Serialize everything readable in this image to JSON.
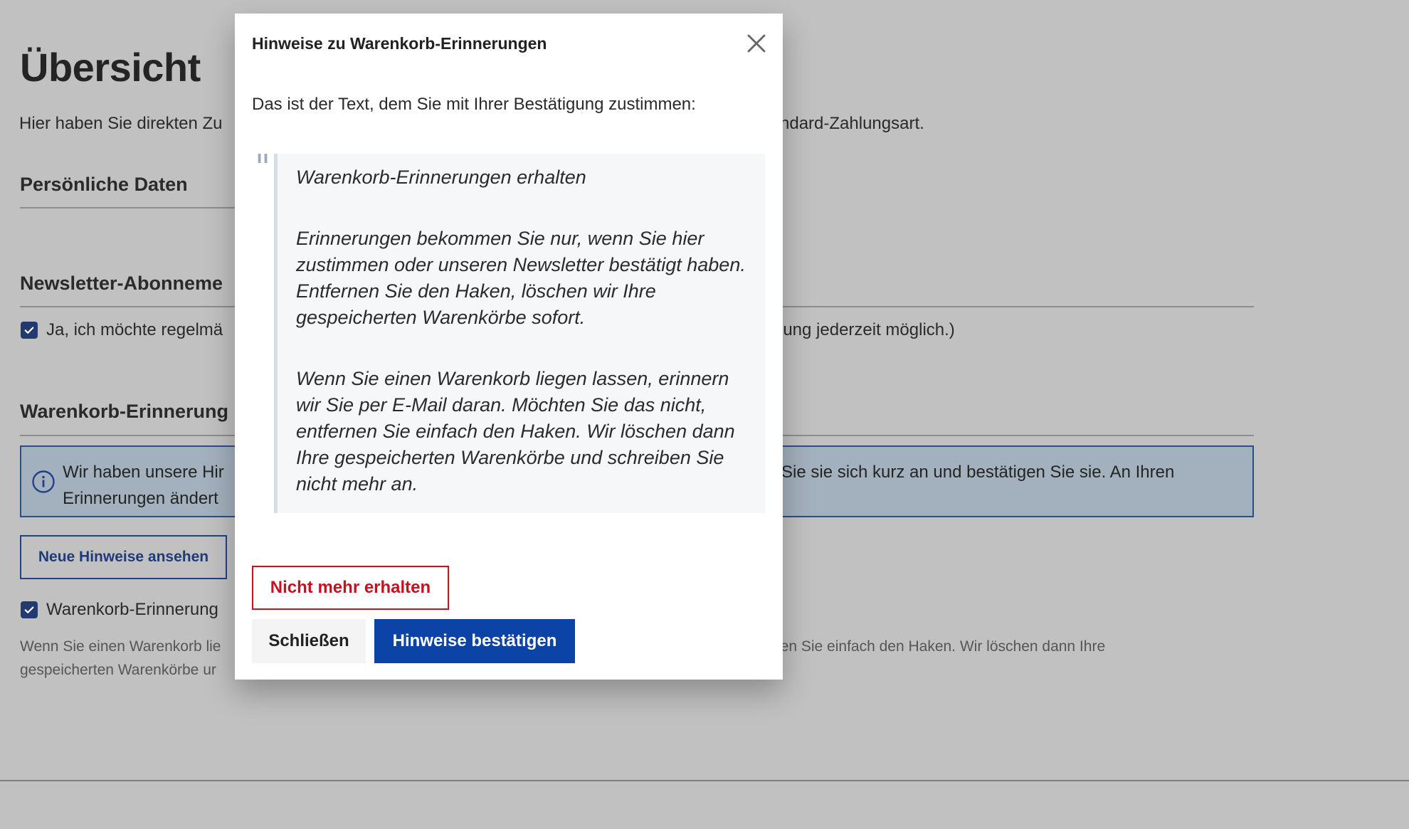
{
  "page": {
    "title": "Übersicht",
    "intro_left": "Hier haben Sie direkten Zu",
    "intro_right": "ndard-Zahlungsart.",
    "sections": {
      "personal": "Persönliche Daten",
      "newsletter": "Newsletter-Abonneme",
      "cart_reminders": "Warenkorb-Erinnerung"
    },
    "newsletter_checkbox": {
      "label_left": "Ja, ich möchte regelmä",
      "label_right": "lung jederzeit möglich.)",
      "checked": true
    },
    "info_box": {
      "line1_left": "Wir haben unsere Hir",
      "line2_left": "Erinnerungen ändert",
      "line1_right": "Sie sie sich kurz an und bestätigen Sie sie. An Ihren"
    },
    "view_notes_button": "Neue Hinweise ansehen",
    "cart_checkbox": {
      "label": "Warenkorb-Erinnerung",
      "checked": true
    },
    "cart_text": {
      "line1_left": "Wenn Sie einen Warenkorb lie",
      "line2_left": "gespeicherten Warenkörbe ur",
      "line1_right": "nen Sie einfach den Haken. Wir löschen dann Ihre"
    }
  },
  "modal": {
    "title": "Hinweise zu Warenkorb-Erinnerungen",
    "intro": "Das ist der Text, dem Sie mit Ihrer Bestätigung zustimmen:",
    "quote_mark": "\"",
    "quote": [
      "Warenkorb-Erinnerungen erhalten",
      "Erinnerungen bekommen Sie nur, wenn Sie hier zustimmen oder unseren Newsletter bestätigt haben. Entfernen Sie den Haken, löschen wir Ihre gespeicherten Warenkörbe sofort.",
      "Wenn Sie einen Warenkorb liegen lassen, erinnern wir Sie per E-Mail daran. Möchten Sie das nicht, entfernen Sie einfach den Haken. Wir löschen dann Ihre gespeicherten Warenkörbe und schreiben Sie nicht mehr an."
    ],
    "buttons": {
      "decline": "Nicht mehr erhalten",
      "close": "Schließen",
      "confirm": "Hinweise bestätigen"
    }
  },
  "colors": {
    "overlay_bg": "#c1c1c1",
    "primary": "#0c43a6",
    "danger": "#c8101e",
    "info_border": "#2c4e86"
  },
  "icons": {
    "close": "close-icon",
    "info": "info-icon",
    "checkbox": "checkmark-icon"
  }
}
